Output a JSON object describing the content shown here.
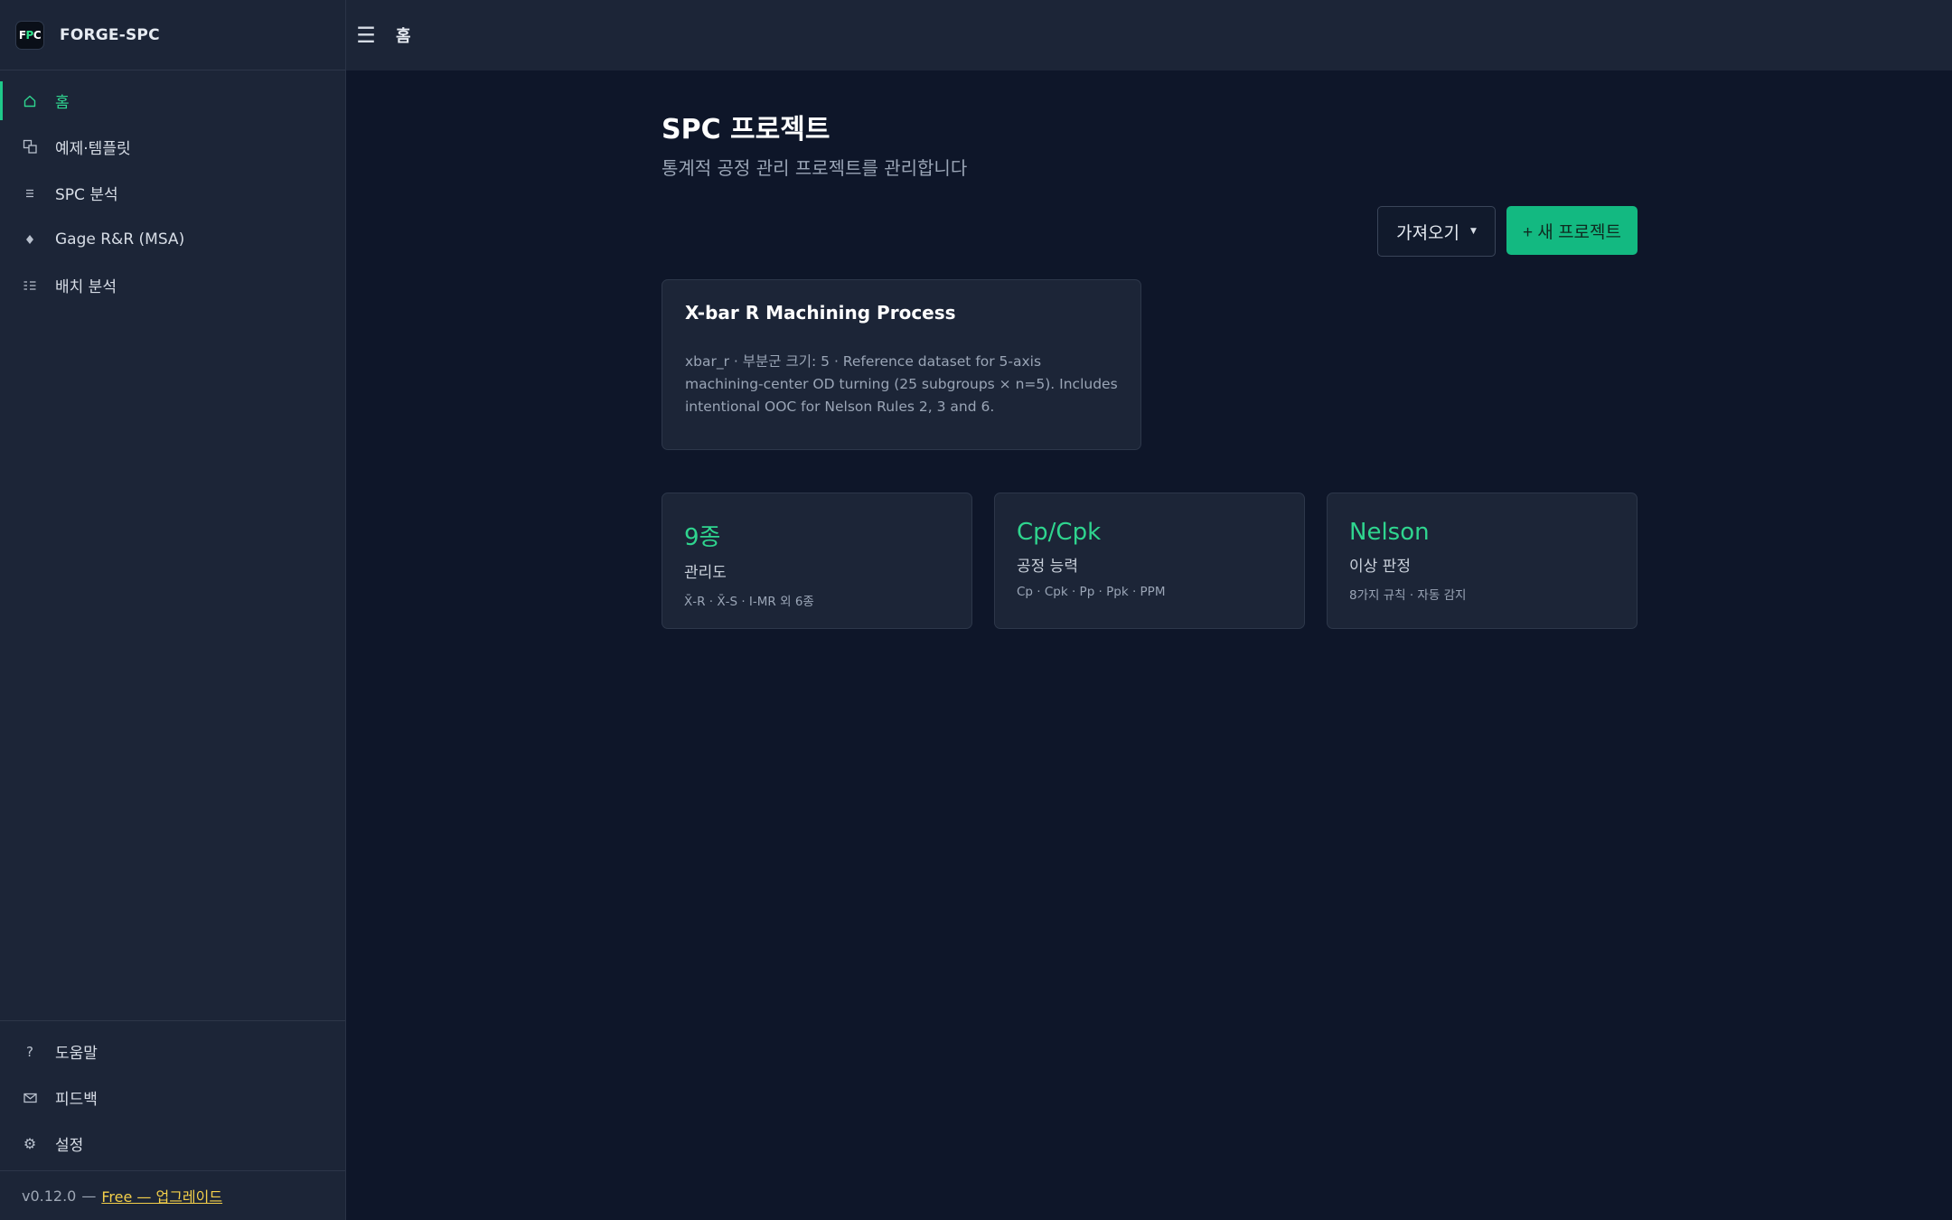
{
  "brand": {
    "logo": {
      "f": "F",
      "p": "P",
      "c": "C"
    },
    "name": "FORGE-SPC"
  },
  "topbar": {
    "menu_icon": "menu-icon",
    "title": "홈"
  },
  "sidebar": {
    "items": [
      {
        "icon": "home-icon",
        "label": "홈",
        "active": true
      },
      {
        "icon": "templates-icon",
        "label": "예제·템플릿",
        "active": false
      },
      {
        "icon": "list-icon",
        "label": "SPC 분석",
        "active": false
      },
      {
        "icon": "diamond-icon",
        "label": "Gage R&R (MSA)",
        "active": false
      },
      {
        "icon": "batch-list-icon",
        "label": "배치 분석",
        "active": false
      }
    ],
    "bottom_items": [
      {
        "icon": "help-icon",
        "label": "도움말"
      },
      {
        "icon": "mail-icon",
        "label": "피드백"
      },
      {
        "icon": "gear-icon",
        "label": "설정"
      }
    ],
    "version": "v0.12.0",
    "version_sep": "—",
    "plan_link": "Free — 업그레이드"
  },
  "main": {
    "title": "SPC 프로젝트",
    "subtitle": "통계적 공정 관리 프로젝트를 관리합니다",
    "import_label": "가져오기",
    "new_project_label": "+ 새 프로젝트",
    "project": {
      "title": "X-bar R Machining Process",
      "description": "xbar_r · 부분군 크기: 5  · Reference dataset for 5-axis machining-center OD turning (25 subgroups × n=5). Includes intentional OOC for Nelson Rules 2, 3 and 6."
    },
    "stats": [
      {
        "value": "9종",
        "name": "관리도",
        "detail": "X̄-R · X̄-S · I-MR 외 6종"
      },
      {
        "value": "Cp/Cpk",
        "name": "공정 능력",
        "detail": "Cp · Cpk · Pp · Ppk · PPM"
      },
      {
        "value": "Nelson",
        "name": "이상 판정",
        "detail": "8가지 규칙 · 자동 감지"
      }
    ]
  },
  "colors": {
    "accent": "#13b981",
    "active_text": "#2fd58f",
    "background": "#0e1629",
    "panel": "#1c2537",
    "upgrade_link": "#f3cf4a"
  }
}
